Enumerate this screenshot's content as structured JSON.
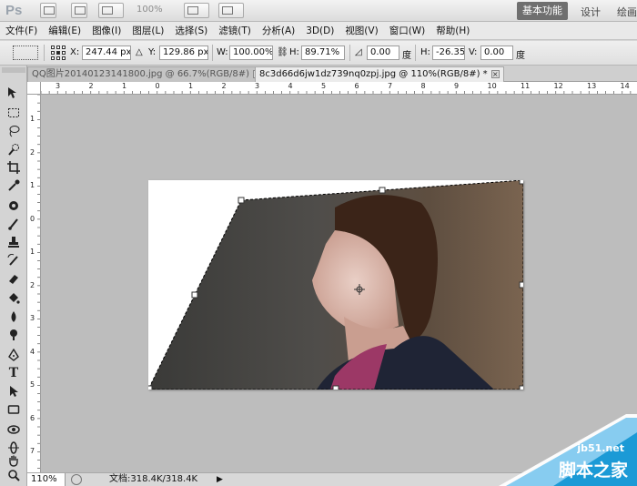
{
  "app": {
    "logo": "Ps",
    "zoom_display": "100%",
    "workspaces": [
      "基本功能",
      "设计",
      "绘画"
    ],
    "active_workspace": "基本功能"
  },
  "menu": [
    "文件(F)",
    "编辑(E)",
    "图像(I)",
    "图层(L)",
    "选择(S)",
    "滤镜(T)",
    "分析(A)",
    "3D(D)",
    "视图(V)",
    "窗口(W)",
    "帮助(H)"
  ],
  "options": {
    "x_label": "X:",
    "x_value": "247.44 px",
    "y_label": "Y:",
    "y_value": "129.86 px",
    "w_label": "W:",
    "w_value": "100.00%",
    "h_label": "H:",
    "h_value": "89.71%",
    "angle_value": "0.00",
    "degree_unit": "度",
    "hskew_label": "H:",
    "hskew_value": "-26.35",
    "vskew_label": "V:",
    "vskew_value": "0.00"
  },
  "tabs": [
    {
      "label": "QQ图片20140123141800.jpg @ 66.7%(RGB/8#)",
      "active": false
    },
    {
      "label": "8c3d66d6jw1dz739nq0zpj.jpg @ 110%(RGB/8#) *",
      "active": true
    }
  ],
  "ruler": {
    "h_labels": [
      "3",
      "2",
      "1",
      "0",
      "1",
      "2",
      "3",
      "4",
      "5",
      "6",
      "7",
      "8",
      "9",
      "10",
      "11",
      "12",
      "13",
      "14"
    ],
    "v_labels": [
      "1",
      "2",
      "1",
      "0",
      "1",
      "2",
      "3",
      "4",
      "5",
      "6",
      "7",
      "8"
    ]
  },
  "status": {
    "zoom": "110%",
    "doc_info": "文档:318.4K/318.4K"
  },
  "watermark": {
    "site": "jb51.net",
    "name": "脚本之家"
  },
  "colors": {
    "workspace": "#bdbdbd",
    "watermark_blue": "#1b9ad6"
  },
  "icons": [
    "move-tool-icon",
    "marquee-tool-icon",
    "lasso-tool-icon",
    "quick-select-icon",
    "crop-tool-icon",
    "eyedropper-icon",
    "healing-brush-icon",
    "brush-tool-icon",
    "clone-stamp-icon",
    "history-brush-icon",
    "eraser-icon",
    "paint-bucket-icon",
    "blur-tool-icon",
    "dodge-tool-icon",
    "pen-tool-icon",
    "type-tool-icon",
    "path-select-icon",
    "shape-tool-icon",
    "3d-rotate-icon",
    "3d-orbit-icon",
    "hand-tool-icon",
    "zoom-tool-icon"
  ]
}
